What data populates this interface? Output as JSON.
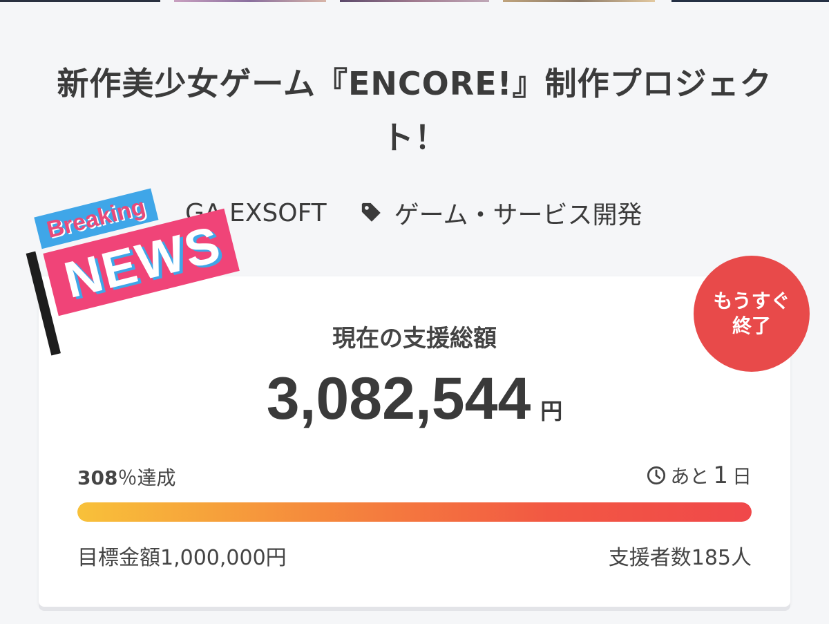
{
  "header": {
    "title": "新作美少女ゲーム『ENCORE!』制作プロジェクト！"
  },
  "meta": {
    "owner": "GA EXSOFT",
    "category": "ゲーム・サービス開発",
    "tag_icon": "tag-icon"
  },
  "sticker": {
    "breaking": "Breaking",
    "news": "NEWS"
  },
  "badge": {
    "line1": "もうすぐ",
    "line2": "終了"
  },
  "funding": {
    "label": "現在の支援総額",
    "amount": "3,082,544",
    "unit": "円",
    "percent_value": "308",
    "percent_suffix": "％達成",
    "remaining_prefix": "あと",
    "remaining_days": "1",
    "remaining_unit": "日",
    "clock_icon": "clock-icon",
    "progress_fraction": 1.0,
    "goal": "目標金額1,000,000円",
    "backers": "支援者数185人"
  },
  "colors": {
    "badge": "#e84a4a",
    "progress_start": "#f8c13a",
    "progress_end": "#f0484a",
    "news_pink": "#f04478",
    "news_blue": "#3fa6e8"
  }
}
